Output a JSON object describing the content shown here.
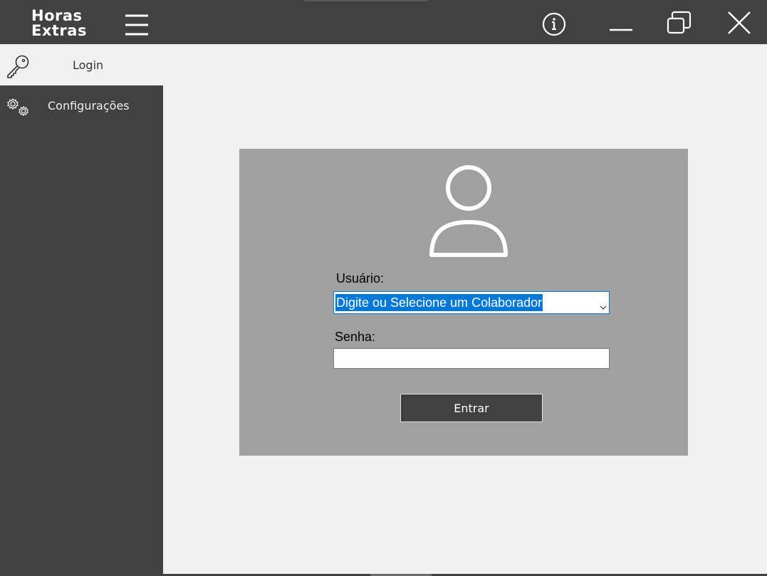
{
  "app": {
    "logo_line1": "Horas",
    "logo_line2": "Extras"
  },
  "titlebar": {
    "icons": [
      "menu-icon",
      "info-icon",
      "minimize-icon",
      "restore-icon",
      "close-icon"
    ]
  },
  "sidebar": {
    "items": [
      {
        "label": "Login",
        "icon": "key-icon",
        "active": true
      },
      {
        "label": "Configurações",
        "icon": "gears-icon",
        "active": false
      }
    ]
  },
  "login_form": {
    "avatar_icon": "user-icon",
    "user_label": "Usuário:",
    "user_combo_value": "Digite ou Selecione um Colaborador",
    "password_label": "Senha:",
    "password_value": "",
    "submit_label": "Entrar"
  },
  "colors": {
    "chrome": "#414141",
    "background": "#f0f0f0",
    "panel": "#a0a0a0",
    "selection": "#0078d7"
  }
}
